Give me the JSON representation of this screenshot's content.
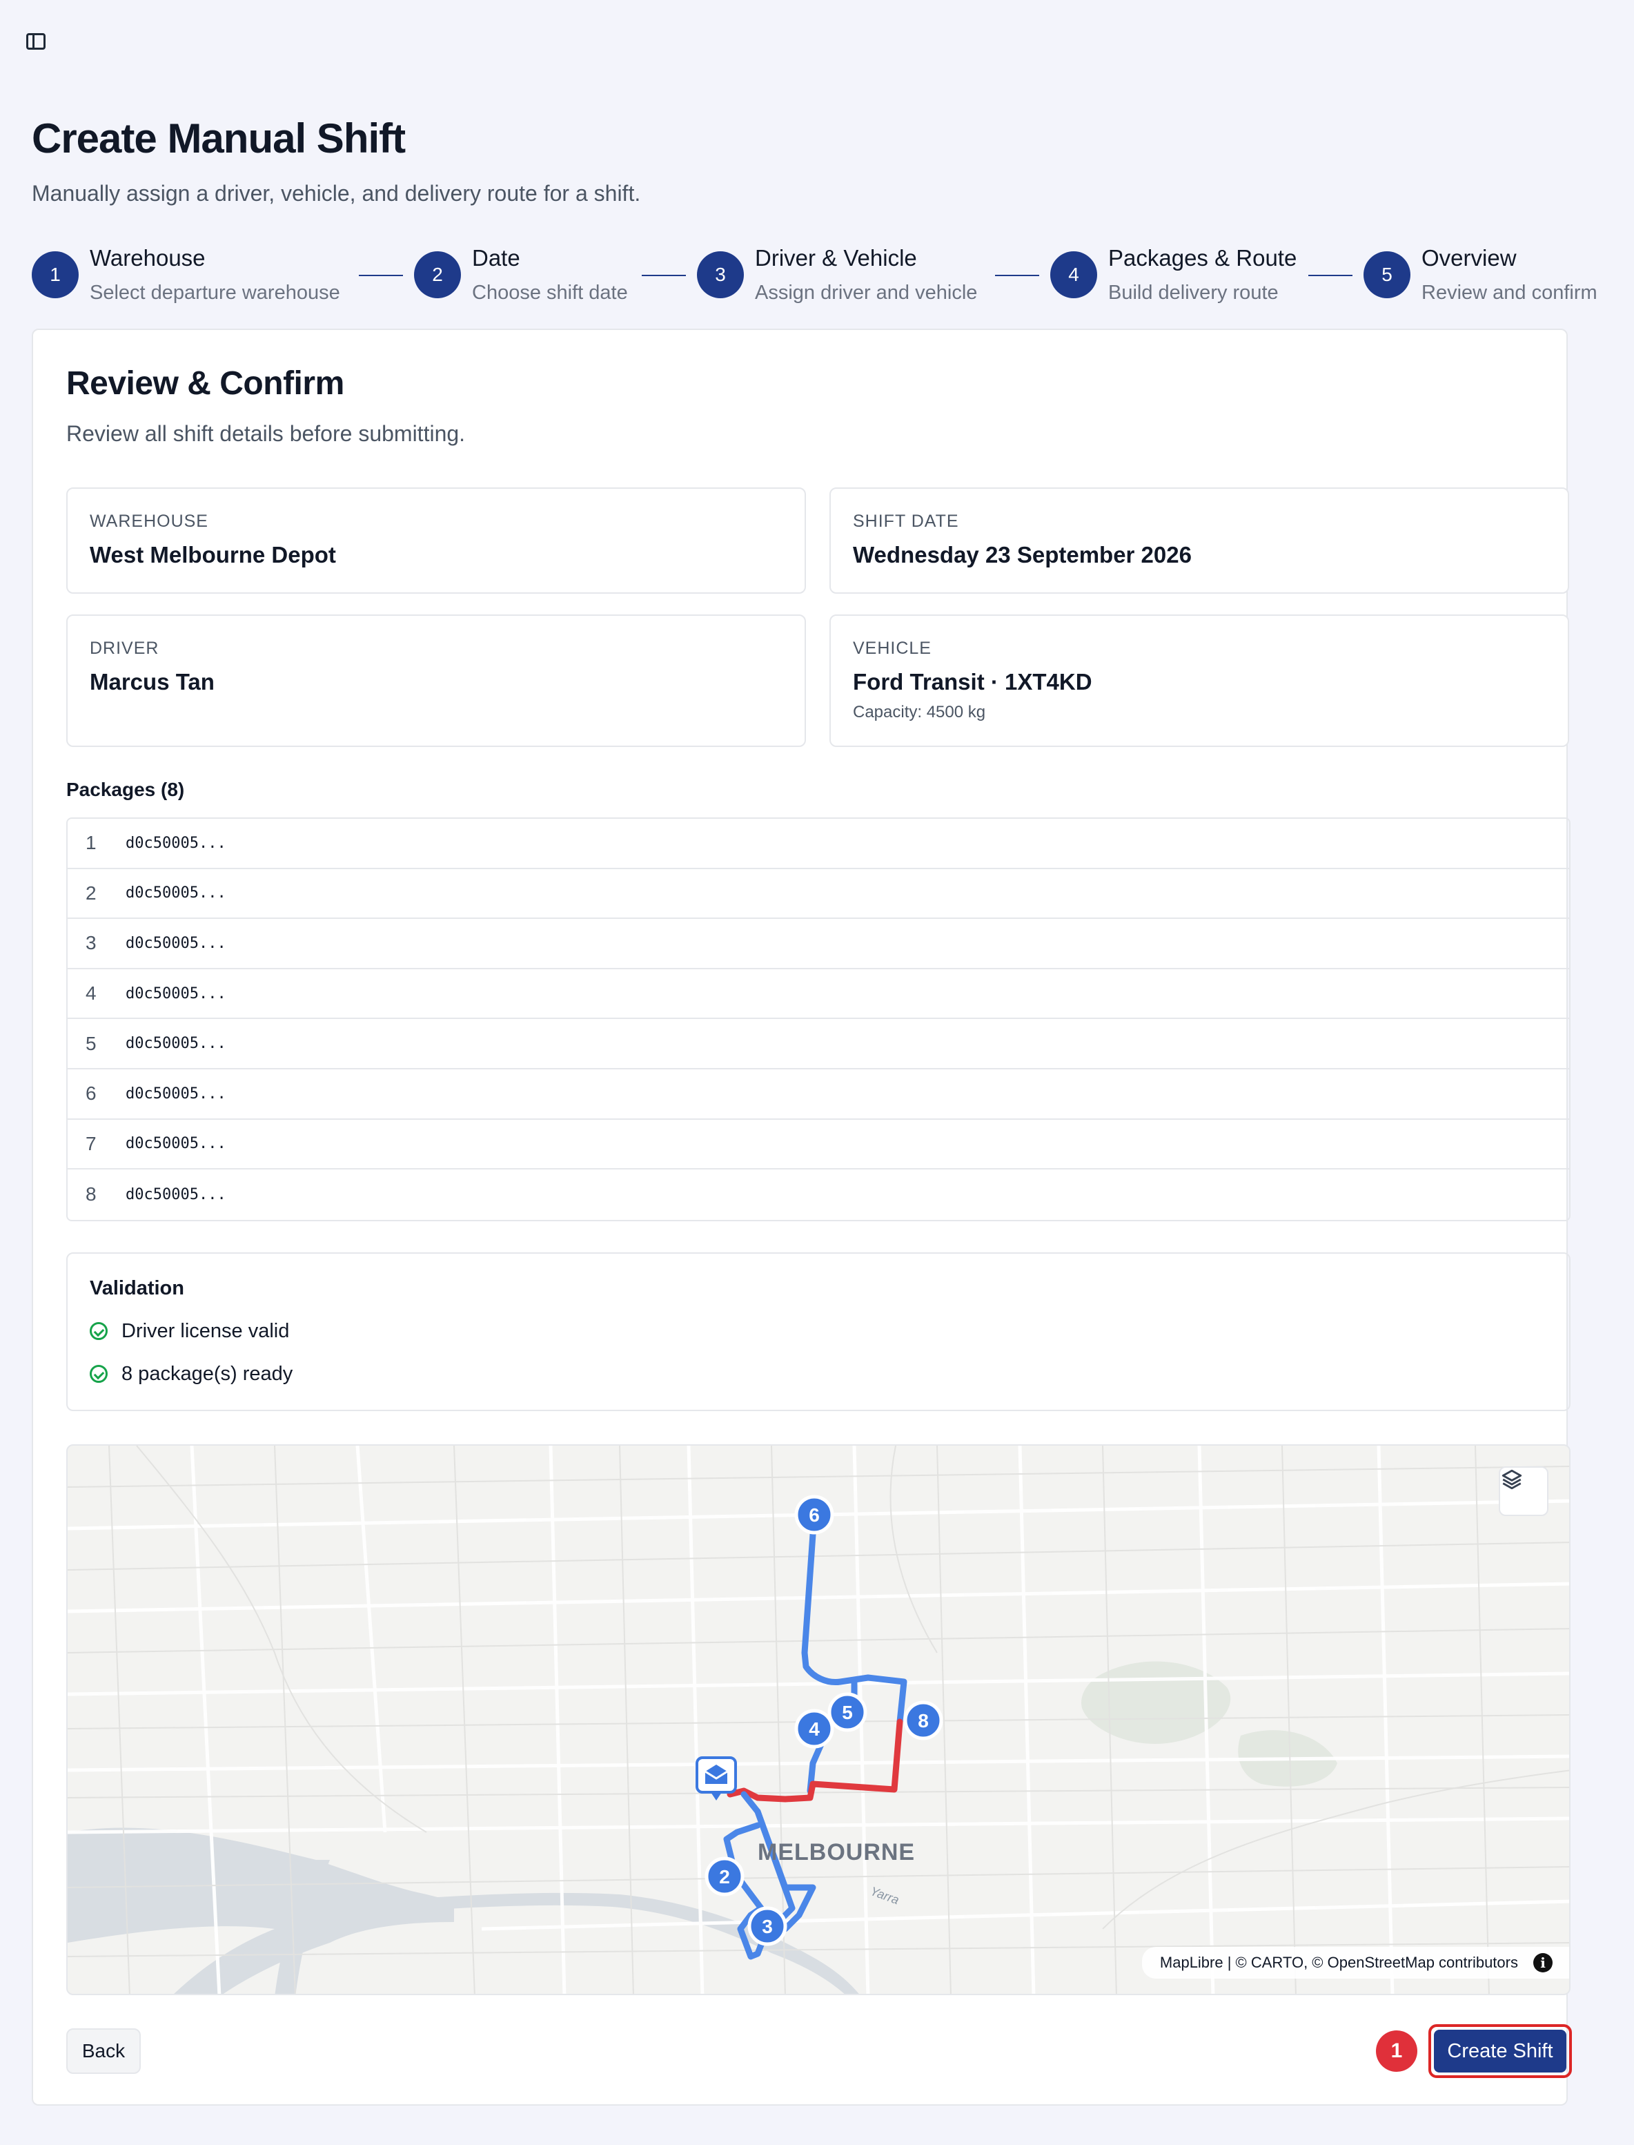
{
  "page": {
    "title": "Create Manual Shift",
    "subtitle": "Manually assign a driver, vehicle, and delivery route for a shift."
  },
  "steps": [
    {
      "number": "1",
      "title": "Warehouse",
      "description": "Select departure warehouse"
    },
    {
      "number": "2",
      "title": "Date",
      "description": "Choose shift date"
    },
    {
      "number": "3",
      "title": "Driver & Vehicle",
      "description": "Assign driver and vehicle"
    },
    {
      "number": "4",
      "title": "Packages & Route",
      "description": "Build delivery route"
    },
    {
      "number": "5",
      "title": "Overview",
      "description": "Review and confirm"
    }
  ],
  "review": {
    "title": "Review & Confirm",
    "subtitle": "Review all shift details before submitting.",
    "warehouse": {
      "label": "WAREHOUSE",
      "value": "West Melbourne Depot"
    },
    "shift_date": {
      "label": "SHIFT DATE",
      "value": "Wednesday 23 September 2026"
    },
    "driver": {
      "label": "DRIVER",
      "value": "Marcus Tan"
    },
    "vehicle": {
      "label": "VEHICLE",
      "value": "Ford Transit · 1XT4KD",
      "capacity": "Capacity: 4500 kg"
    }
  },
  "packages": {
    "heading": "Packages (8)",
    "rows": [
      {
        "num": "1",
        "id": "d0c50005..."
      },
      {
        "num": "2",
        "id": "d0c50005..."
      },
      {
        "num": "3",
        "id": "d0c50005..."
      },
      {
        "num": "4",
        "id": "d0c50005..."
      },
      {
        "num": "5",
        "id": "d0c50005..."
      },
      {
        "num": "6",
        "id": "d0c50005..."
      },
      {
        "num": "7",
        "id": "d0c50005..."
      },
      {
        "num": "8",
        "id": "d0c50005..."
      }
    ]
  },
  "validation": {
    "title": "Validation",
    "items": [
      "Driver license valid",
      "8 package(s) ready"
    ]
  },
  "map": {
    "city_label": "MELBOURNE",
    "river_label": "Yarra",
    "attribution": "MapLibre | © CARTO, © OpenStreetMap contributors",
    "layers_icon": "layers-icon",
    "depot_icon": "warehouse-marker-icon",
    "stop_labels": [
      "2",
      "3",
      "4",
      "5",
      "6",
      "8"
    ],
    "colors": {
      "route": "#4a86e8",
      "highlight": "#e0393e",
      "marker": "#3b78e0"
    }
  },
  "actions": {
    "back": "Back",
    "create": "Create Shift",
    "badge": "1"
  },
  "colors": {
    "primary": "#1e3a8a",
    "success": "#16a34a",
    "danger": "#dc2626"
  }
}
